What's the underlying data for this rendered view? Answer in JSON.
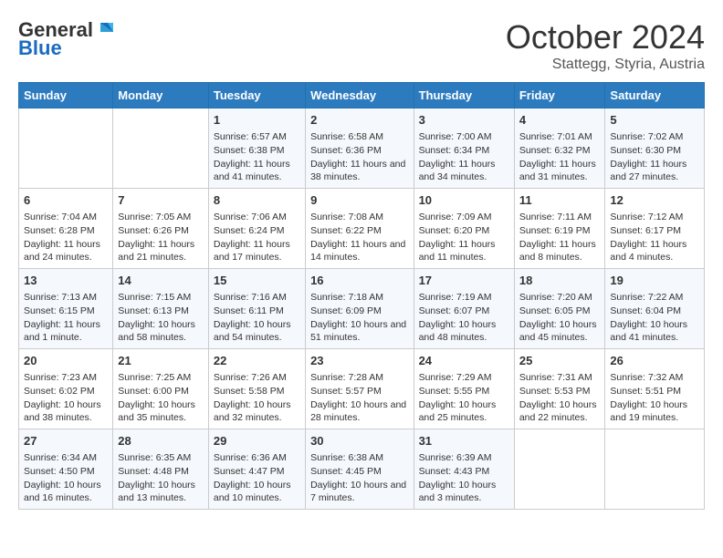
{
  "header": {
    "logo_general": "General",
    "logo_blue": "Blue",
    "month_title": "October 2024",
    "subtitle": "Stattegg, Styria, Austria"
  },
  "days_of_week": [
    "Sunday",
    "Monday",
    "Tuesday",
    "Wednesday",
    "Thursday",
    "Friday",
    "Saturday"
  ],
  "weeks": [
    [
      {
        "day": null,
        "info": null
      },
      {
        "day": null,
        "info": null
      },
      {
        "day": "1",
        "info": "Sunrise: 6:57 AM\nSunset: 6:38 PM\nDaylight: 11 hours and 41 minutes."
      },
      {
        "day": "2",
        "info": "Sunrise: 6:58 AM\nSunset: 6:36 PM\nDaylight: 11 hours and 38 minutes."
      },
      {
        "day": "3",
        "info": "Sunrise: 7:00 AM\nSunset: 6:34 PM\nDaylight: 11 hours and 34 minutes."
      },
      {
        "day": "4",
        "info": "Sunrise: 7:01 AM\nSunset: 6:32 PM\nDaylight: 11 hours and 31 minutes."
      },
      {
        "day": "5",
        "info": "Sunrise: 7:02 AM\nSunset: 6:30 PM\nDaylight: 11 hours and 27 minutes."
      }
    ],
    [
      {
        "day": "6",
        "info": "Sunrise: 7:04 AM\nSunset: 6:28 PM\nDaylight: 11 hours and 24 minutes."
      },
      {
        "day": "7",
        "info": "Sunrise: 7:05 AM\nSunset: 6:26 PM\nDaylight: 11 hours and 21 minutes."
      },
      {
        "day": "8",
        "info": "Sunrise: 7:06 AM\nSunset: 6:24 PM\nDaylight: 11 hours and 17 minutes."
      },
      {
        "day": "9",
        "info": "Sunrise: 7:08 AM\nSunset: 6:22 PM\nDaylight: 11 hours and 14 minutes."
      },
      {
        "day": "10",
        "info": "Sunrise: 7:09 AM\nSunset: 6:20 PM\nDaylight: 11 hours and 11 minutes."
      },
      {
        "day": "11",
        "info": "Sunrise: 7:11 AM\nSunset: 6:19 PM\nDaylight: 11 hours and 8 minutes."
      },
      {
        "day": "12",
        "info": "Sunrise: 7:12 AM\nSunset: 6:17 PM\nDaylight: 11 hours and 4 minutes."
      }
    ],
    [
      {
        "day": "13",
        "info": "Sunrise: 7:13 AM\nSunset: 6:15 PM\nDaylight: 11 hours and 1 minute."
      },
      {
        "day": "14",
        "info": "Sunrise: 7:15 AM\nSunset: 6:13 PM\nDaylight: 10 hours and 58 minutes."
      },
      {
        "day": "15",
        "info": "Sunrise: 7:16 AM\nSunset: 6:11 PM\nDaylight: 10 hours and 54 minutes."
      },
      {
        "day": "16",
        "info": "Sunrise: 7:18 AM\nSunset: 6:09 PM\nDaylight: 10 hours and 51 minutes."
      },
      {
        "day": "17",
        "info": "Sunrise: 7:19 AM\nSunset: 6:07 PM\nDaylight: 10 hours and 48 minutes."
      },
      {
        "day": "18",
        "info": "Sunrise: 7:20 AM\nSunset: 6:05 PM\nDaylight: 10 hours and 45 minutes."
      },
      {
        "day": "19",
        "info": "Sunrise: 7:22 AM\nSunset: 6:04 PM\nDaylight: 10 hours and 41 minutes."
      }
    ],
    [
      {
        "day": "20",
        "info": "Sunrise: 7:23 AM\nSunset: 6:02 PM\nDaylight: 10 hours and 38 minutes."
      },
      {
        "day": "21",
        "info": "Sunrise: 7:25 AM\nSunset: 6:00 PM\nDaylight: 10 hours and 35 minutes."
      },
      {
        "day": "22",
        "info": "Sunrise: 7:26 AM\nSunset: 5:58 PM\nDaylight: 10 hours and 32 minutes."
      },
      {
        "day": "23",
        "info": "Sunrise: 7:28 AM\nSunset: 5:57 PM\nDaylight: 10 hours and 28 minutes."
      },
      {
        "day": "24",
        "info": "Sunrise: 7:29 AM\nSunset: 5:55 PM\nDaylight: 10 hours and 25 minutes."
      },
      {
        "day": "25",
        "info": "Sunrise: 7:31 AM\nSunset: 5:53 PM\nDaylight: 10 hours and 22 minutes."
      },
      {
        "day": "26",
        "info": "Sunrise: 7:32 AM\nSunset: 5:51 PM\nDaylight: 10 hours and 19 minutes."
      }
    ],
    [
      {
        "day": "27",
        "info": "Sunrise: 6:34 AM\nSunset: 4:50 PM\nDaylight: 10 hours and 16 minutes."
      },
      {
        "day": "28",
        "info": "Sunrise: 6:35 AM\nSunset: 4:48 PM\nDaylight: 10 hours and 13 minutes."
      },
      {
        "day": "29",
        "info": "Sunrise: 6:36 AM\nSunset: 4:47 PM\nDaylight: 10 hours and 10 minutes."
      },
      {
        "day": "30",
        "info": "Sunrise: 6:38 AM\nSunset: 4:45 PM\nDaylight: 10 hours and 7 minutes."
      },
      {
        "day": "31",
        "info": "Sunrise: 6:39 AM\nSunset: 4:43 PM\nDaylight: 10 hours and 3 minutes."
      },
      {
        "day": null,
        "info": null
      },
      {
        "day": null,
        "info": null
      }
    ]
  ]
}
